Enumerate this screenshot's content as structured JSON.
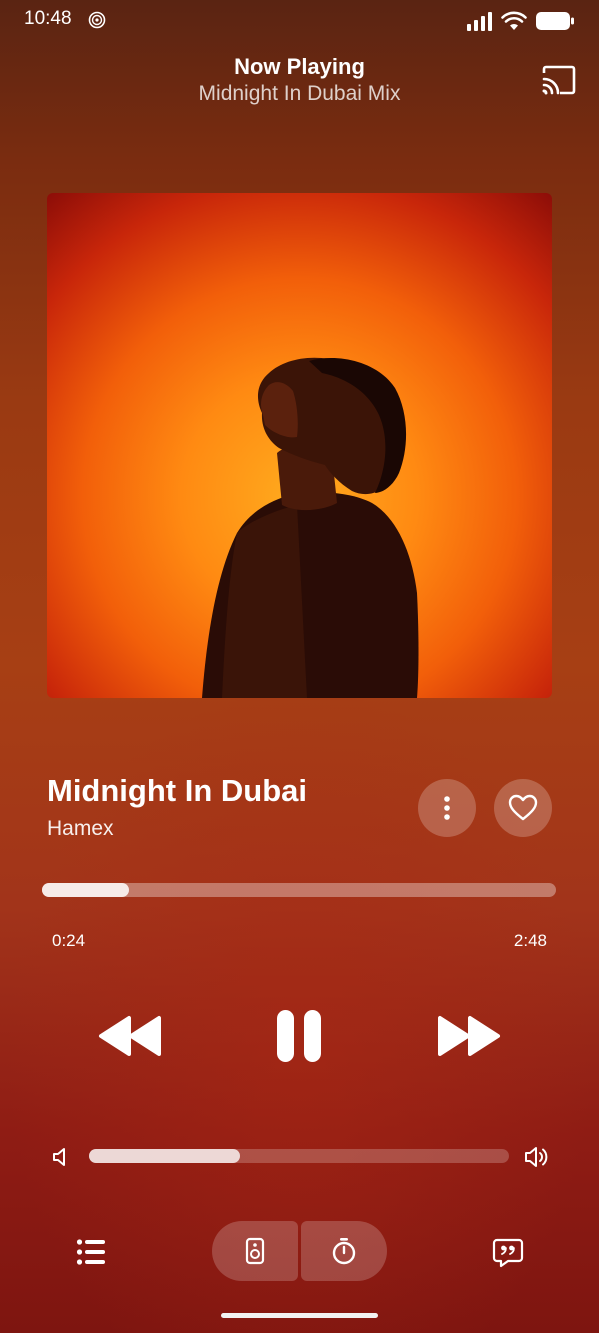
{
  "status_bar": {
    "time": "10:48"
  },
  "header": {
    "title": "Now Playing",
    "subtitle": "Midnight In Dubai Mix"
  },
  "track": {
    "title": "Midnight In Dubai",
    "artist": "Hamex",
    "liked": false
  },
  "playback": {
    "elapsed": "0:24",
    "total": "2:48",
    "progress_fraction": 0.17,
    "state": "playing"
  },
  "volume": {
    "level_fraction": 0.36
  },
  "icons": {
    "status": [
      "ring-icon",
      "signal-icon",
      "wifi-icon",
      "battery-icon"
    ],
    "header": [
      "cast-icon"
    ],
    "track": [
      "more-vertical-icon",
      "heart-outline-icon"
    ],
    "transport": [
      "rewind-icon",
      "pause-icon",
      "fast-forward-icon"
    ],
    "volume": [
      "volume-low-icon",
      "volume-high-icon"
    ],
    "bottom": [
      "queue-icon",
      "speaker-icon",
      "timer-icon",
      "lyrics-icon"
    ]
  },
  "colors": {
    "background_top": "#5a2412",
    "background_mid": "#a73f14",
    "background_bottom": "#7e1510",
    "artwork_glow": "#ffab1e",
    "artwork_edge": "#8c0d08"
  }
}
